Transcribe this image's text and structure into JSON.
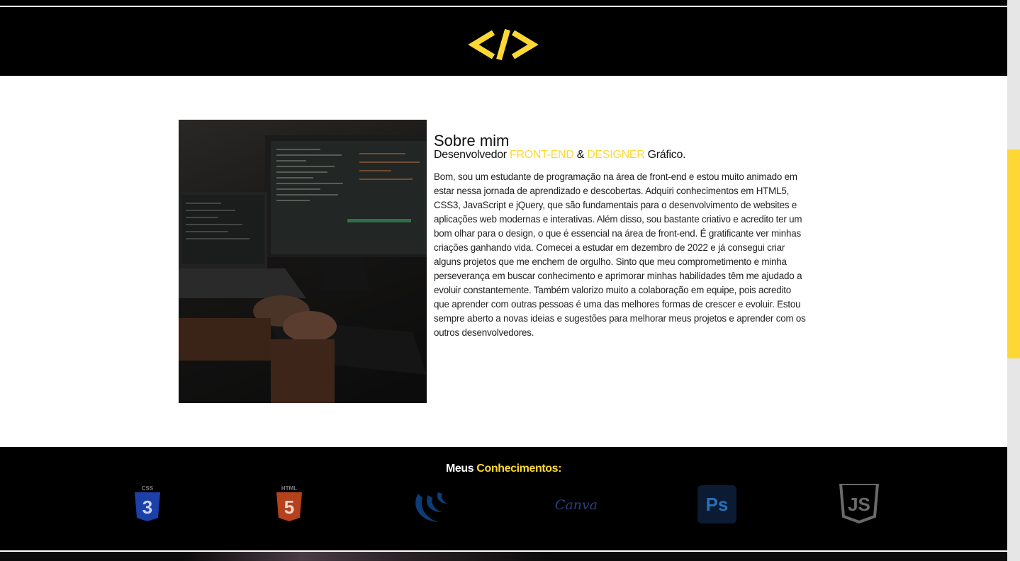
{
  "header": {
    "logo_icon": "code-brackets-icon",
    "logo_color": "#fdd835"
  },
  "about": {
    "photo": "person-coding-at-laptop-and-monitor-image",
    "title": "Sobre mim",
    "subtitle_prefix": "Desenvolvedor ",
    "subtitle_highlight_1": "FRONT-END",
    "subtitle_amp": " & ",
    "subtitle_highlight_2": "DESIGNER",
    "subtitle_suffix": " Gráfico.",
    "body": "Bom, sou um estudante de programação na área de front-end e estou muito animado em estar nessa jornada de aprendizado e descobertas. Adquiri conhecimentos em HTML5, CSS3, JavaScript e jQuery, que são fundamentais para o desenvolvimento de websites e aplicações web modernas e interativas. Além disso, sou bastante criativo e acredito ter um bom olhar para o design, o que é essencial na área de front-end. É gratificante ver minhas criações ganhando vida. Comecei a estudar em dezembro de 2022 e já consegui criar alguns projetos que me enchem de orgulho. Sinto que meu comprometimento e minha perseverança em buscar conhecimento e aprimorar minhas habilidades têm me ajudado a evoluir constantemente. Também valorizo muito a colaboração em equipe, pois acredito que aprender com outras pessoas é uma das melhores formas de crescer e evoluir. Estou sempre aberto a novas ideias e sugestões para melhorar meus projetos e aprender com os outros desenvolvedores."
  },
  "skills": {
    "title_prefix": "Meus ",
    "title_highlight": "Conhecimentos:",
    "items": [
      {
        "icon": "css3-icon",
        "label": "CSS"
      },
      {
        "icon": "html5-icon",
        "label": "HTML"
      },
      {
        "icon": "jquery-icon"
      },
      {
        "icon": "canva-icon",
        "label": "Canva"
      },
      {
        "icon": "photoshop-icon",
        "label": "Ps"
      },
      {
        "icon": "javascript-icon",
        "label": "JS"
      }
    ]
  },
  "colors": {
    "accent": "#fdd835",
    "dark": "#000000"
  }
}
